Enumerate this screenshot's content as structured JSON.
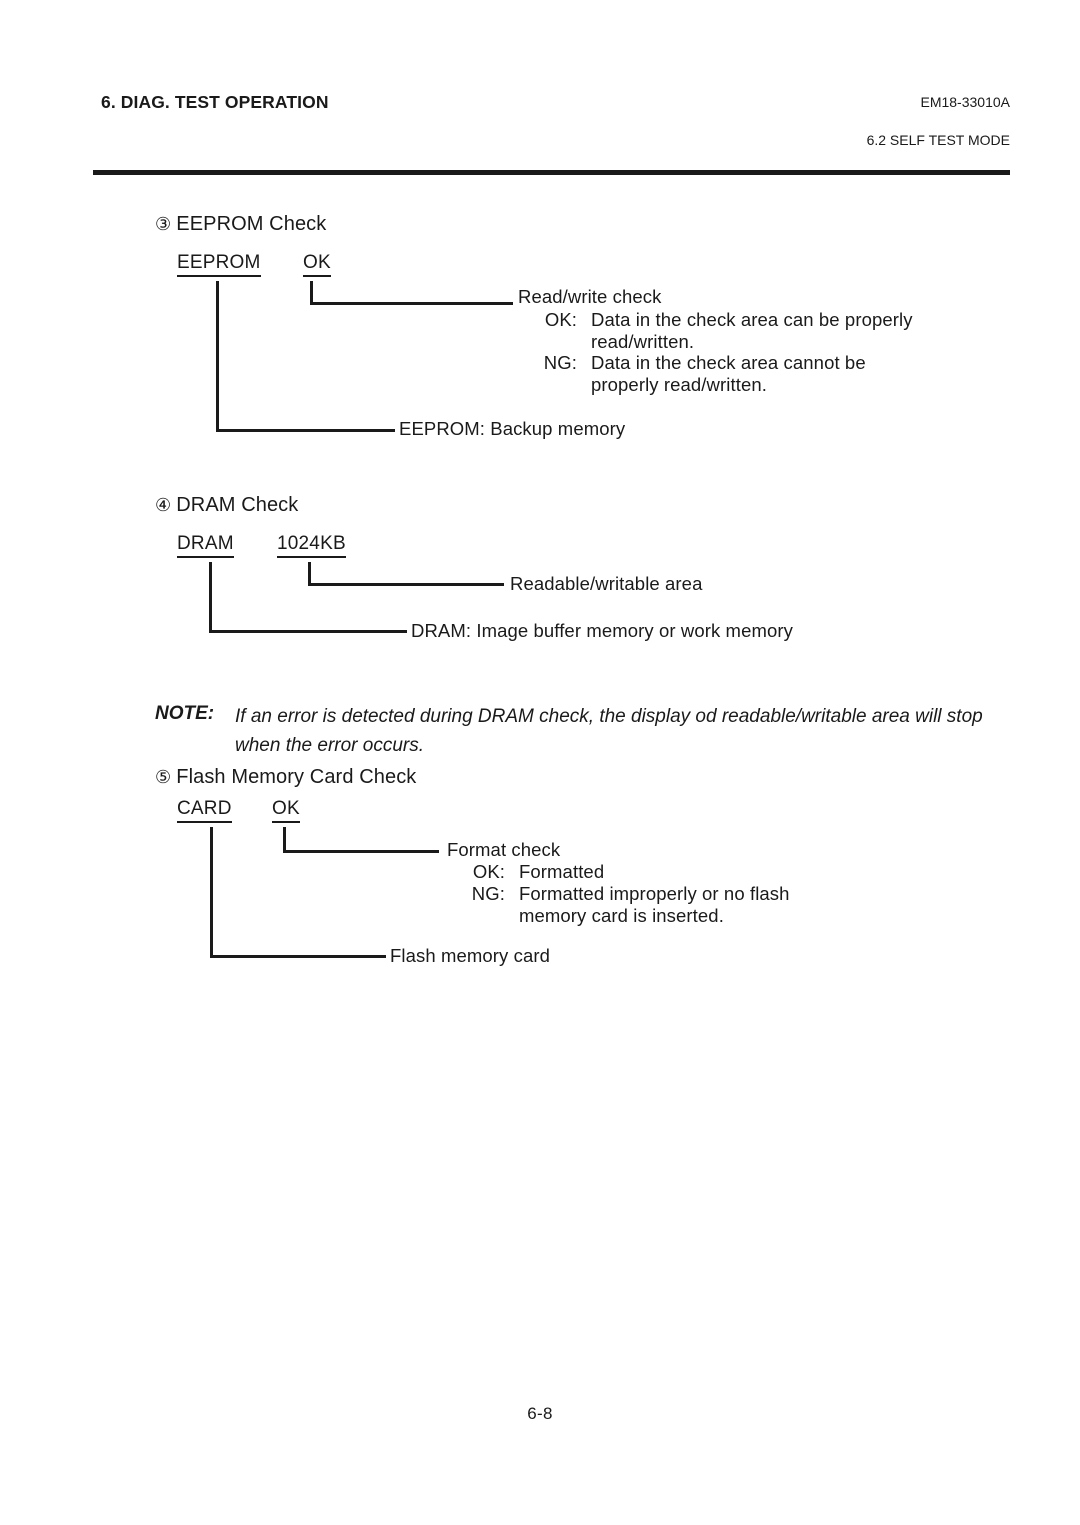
{
  "header": {
    "chapter_title": "6. DIAG. TEST OPERATION",
    "doc_number": "EM18-33010A",
    "section_title": "6.2 SELF TEST MODE"
  },
  "sections": [
    {
      "marker": "③",
      "heading": "EEPROM Check",
      "code": "EEPROM",
      "value": "OK",
      "value_annotation": "Read/write check",
      "results": [
        {
          "tag": "OK:",
          "text": "Data in the check area can be properly",
          "continuation": "read/written."
        },
        {
          "tag": "NG:",
          "text": "Data in the check area cannot be",
          "continuation": "properly read/written."
        }
      ],
      "code_annotation": "EEPROM:  Backup memory"
    },
    {
      "marker": "④",
      "heading": "DRAM Check",
      "code": "DRAM",
      "value": "1024KB",
      "value_annotation": "Readable/writable area",
      "results": [],
      "code_annotation": "DRAM: Image buffer memory or work memory"
    },
    {
      "marker": "⑤",
      "heading": "Flash Memory Card Check",
      "code": "CARD",
      "value": "OK",
      "value_annotation": "Format check",
      "results": [
        {
          "tag": "OK:",
          "text": "Formatted",
          "continuation": ""
        },
        {
          "tag": "NG:",
          "text": "Formatted improperly or no flash",
          "continuation": "memory card is inserted."
        }
      ],
      "code_annotation": "Flash memory card"
    }
  ],
  "note": {
    "label": "NOTE:",
    "text": "If an error is detected during DRAM check, the display od readable/writable area will stop when the error occurs."
  },
  "footer": {
    "page_number": "6-8"
  }
}
